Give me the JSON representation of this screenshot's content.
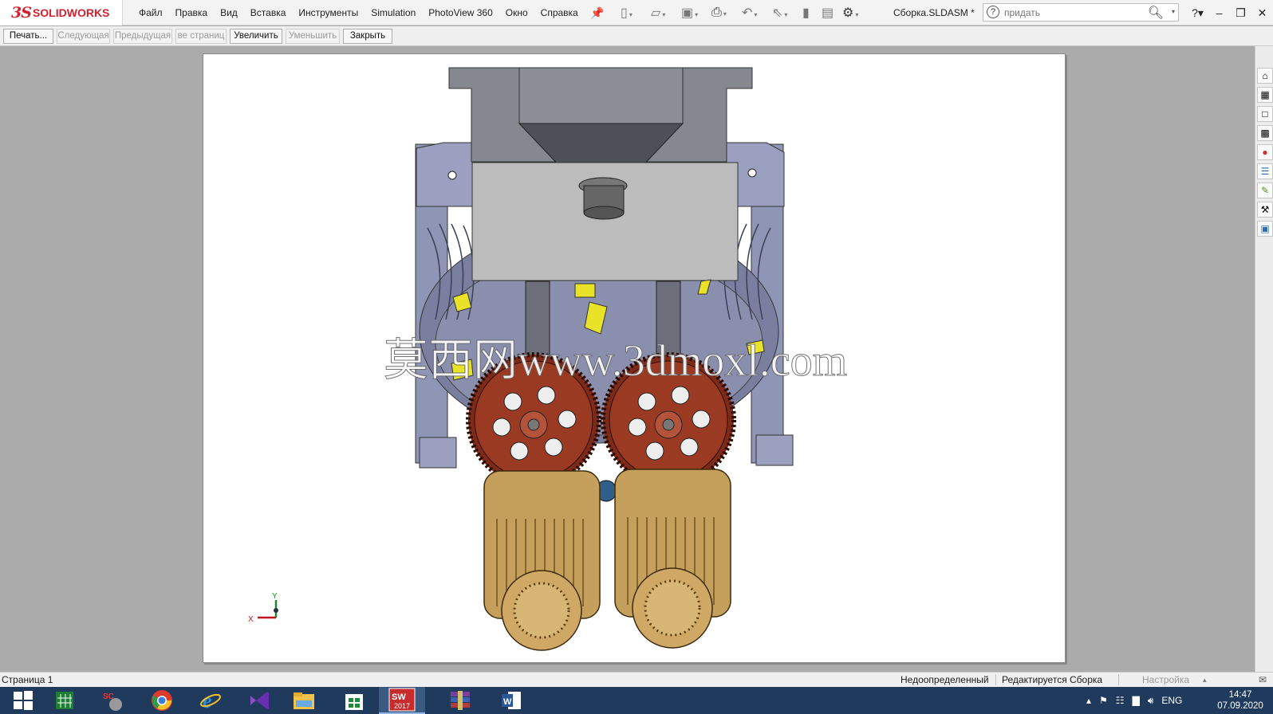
{
  "app": {
    "logo_ds": "3S",
    "logo_brand": "SOLIDWORKS",
    "document_title": "Сборка.SLDASM *"
  },
  "menu": [
    "Файл",
    "Правка",
    "Вид",
    "Вставка",
    "Инструменты",
    "Simulation",
    "PhotoView 360",
    "Окно",
    "Справка"
  ],
  "quick_access_icons": [
    "new-icon",
    "open-icon",
    "save-icon",
    "print-icon",
    "undo-icon",
    "select-icon",
    "rebuild-icon",
    "file-properties-icon",
    "options-icon"
  ],
  "search": {
    "placeholder": "придать",
    "help_glyph": "?"
  },
  "print_preview": {
    "print_label": "Печать...",
    "next_label": "Следующая",
    "prev_label": "Предыдущая",
    "two_pages_label": "ве страниц",
    "zoom_in_label": "Увеличить",
    "zoom_out_label": "Уменьшить",
    "close_label": "Закрыть"
  },
  "drawing": {
    "watermark": "莫西网www.3dmoxl.com",
    "triad_x": "X",
    "triad_y": "Y"
  },
  "status": {
    "page": "Страница 1",
    "definition": "Недоопределенный",
    "editing": "Редактируется Сборка",
    "custom": "Настройка"
  },
  "taskpane_icons": [
    "home-icon",
    "design-library-icon",
    "file-explorer-icon",
    "view-palette-icon",
    "appearances-icon",
    "custom-properties-icon",
    "solidworks-forum-icon",
    "toolbox-icon",
    "recognize-icon"
  ],
  "taskbar": {
    "apps": [
      "windows-start-icon",
      "excel-icon",
      "solidcam-icon",
      "chrome-icon",
      "ie-icon",
      "visual-studio-icon",
      "file-explorer-icon",
      "store-icon",
      "solidworks-2017-icon",
      "winrar-icon",
      "word-icon"
    ],
    "sw_label": "SW",
    "sw_year": "2017",
    "lang": "ENG",
    "time": "14:47",
    "date": "07.09.2020"
  },
  "colors": {
    "frame": "#9096b8",
    "gear": "#9b3a22",
    "motor": "#c4a05c",
    "hopper": "#6c6d72",
    "plate": "#bebebe",
    "paddle": "#e8e229"
  }
}
